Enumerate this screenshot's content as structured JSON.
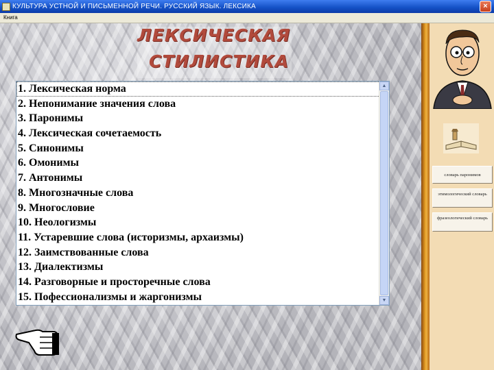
{
  "window": {
    "title": "КУЛЬТУРА УСТНОЙ И ПИСЬМЕННОЙ РЕЧИ. РУССКИЙ ЯЗЫК. ЛЕКСИКА",
    "close_label": "×"
  },
  "menu": {
    "items": [
      "Книга"
    ]
  },
  "heading": {
    "line1": "ЛЕКСИЧЕСКАЯ",
    "line2": "СТИЛИСТИКА"
  },
  "topics": [
    "1. Лексическая норма",
    "2. Непонимание значения слова",
    "3. Паронимы",
    "4. Лексическая сочетаемость",
    "5. Синонимы",
    "6. Омонимы",
    "7. Антонимы",
    "8. Многозначные слова",
    "9. Многословие",
    "10. Неологизмы",
    "11. Устаревшие слова (историзмы, архаизмы)",
    "12. Заимствованные слова",
    "13. Диалектизмы",
    "14. Разговорные и просторечные слова",
    "15. Пофессионализмы и жаргонизмы"
  ],
  "selected_topic_index": 0,
  "sidebar": {
    "buttons": [
      {
        "label": "словарь паронимов"
      },
      {
        "label": "этимологический словарь"
      },
      {
        "label": "фразеологический словарь"
      }
    ]
  },
  "colors": {
    "heading": "#b14a3c",
    "titlebar": "#1653c8",
    "sidebar_bg": "#f3dcb4",
    "divider": "#d8901e"
  },
  "icons": {
    "character": "professor-character-icon",
    "dictionary": "book-dictionary-icon",
    "left_hand": "pointing-hand-left-icon",
    "right_hand": "pointing-hand-right-icon"
  }
}
